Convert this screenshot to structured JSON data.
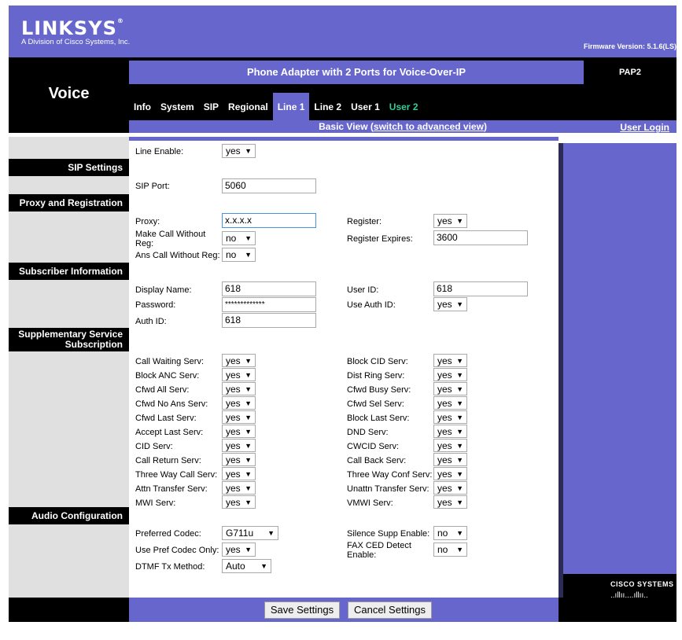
{
  "brand": {
    "logo": "LINKSYS",
    "reg": "®",
    "sub": "A Division of Cisco Systems, Inc."
  },
  "firmware": "Firmware Version: 5.1.6(LS)",
  "section_title": "Voice",
  "banner": "Phone Adapter with 2 Ports for Voice-Over-IP",
  "model": "PAP2",
  "tabs": [
    "Info",
    "System",
    "SIP",
    "Regional",
    "Line 1",
    "Line 2",
    "User 1",
    "User 2"
  ],
  "view": {
    "text": "Basic View",
    "link_open": " (",
    "link": "switch to advanced view",
    "link_close": ")",
    "user_login": "User Login"
  },
  "sections": {
    "sip": "SIP Settings",
    "proxy": "Proxy and Registration",
    "subscriber": "Subscriber Information",
    "supp": "Supplementary Service Subscription",
    "audio": "Audio Configuration"
  },
  "fields": {
    "line_enable": {
      "label": "Line Enable:",
      "value": "yes"
    },
    "sip_port": {
      "label": "SIP Port:",
      "value": "5060"
    },
    "proxy": {
      "label": "Proxy:",
      "value": "x.x.x.x"
    },
    "register": {
      "label": "Register:",
      "value": "yes"
    },
    "make_call": {
      "label": "Make Call Without Reg:",
      "value": "no"
    },
    "reg_expires": {
      "label": "Register Expires:",
      "value": "3600"
    },
    "ans_call": {
      "label": "Ans Call Without Reg:",
      "value": "no"
    },
    "display_name": {
      "label": "Display Name:",
      "value": "618"
    },
    "user_id": {
      "label": "User ID:",
      "value": "618"
    },
    "password": {
      "label": "Password:",
      "value": "*************"
    },
    "use_auth": {
      "label": "Use Auth ID:",
      "value": "yes"
    },
    "auth_id": {
      "label": "Auth ID:",
      "value": "618"
    },
    "pref_codec": {
      "label": "Preferred Codec:",
      "value": "G711u"
    },
    "silence": {
      "label": "Silence Supp Enable:",
      "value": "no"
    },
    "use_pref": {
      "label": "Use Pref Codec Only:",
      "value": "yes"
    },
    "fax_ced": {
      "label": "FAX CED Detect Enable:",
      "value": "no"
    },
    "dtmf": {
      "label": "DTMF Tx Method:",
      "value": "Auto"
    }
  },
  "supp_left": [
    {
      "label": "Call Waiting Serv:",
      "value": "yes"
    },
    {
      "label": "Block ANC Serv:",
      "value": "yes"
    },
    {
      "label": "Cfwd All Serv:",
      "value": "yes"
    },
    {
      "label": "Cfwd No Ans Serv:",
      "value": "yes"
    },
    {
      "label": "Cfwd Last Serv:",
      "value": "yes"
    },
    {
      "label": "Accept Last Serv:",
      "value": "yes"
    },
    {
      "label": "CID Serv:",
      "value": "yes"
    },
    {
      "label": "Call Return Serv:",
      "value": "yes"
    },
    {
      "label": "Three Way Call Serv:",
      "value": "yes"
    },
    {
      "label": "Attn Transfer Serv:",
      "value": "yes"
    },
    {
      "label": "MWI Serv:",
      "value": "yes"
    }
  ],
  "supp_right": [
    {
      "label": "Block CID Serv:",
      "value": "yes"
    },
    {
      "label": "Dist Ring Serv:",
      "value": "yes"
    },
    {
      "label": "Cfwd Busy Serv:",
      "value": "yes"
    },
    {
      "label": "Cfwd Sel Serv:",
      "value": "yes"
    },
    {
      "label": "Block Last Serv:",
      "value": "yes"
    },
    {
      "label": "DND Serv:",
      "value": "yes"
    },
    {
      "label": "CWCID Serv:",
      "value": "yes"
    },
    {
      "label": "Call Back Serv:",
      "value": "yes"
    },
    {
      "label": "Three Way Conf Serv:",
      "value": "yes"
    },
    {
      "label": "Unattn Transfer Serv:",
      "value": "yes"
    },
    {
      "label": "VMWI Serv:",
      "value": "yes"
    }
  ],
  "buttons": {
    "save": "Save Settings",
    "cancel": "Cancel Settings"
  },
  "cisco": {
    "name": "CISCO SYSTEMS",
    "bars": "..ıllıı....ıllıı.."
  },
  "colors": {
    "accent": "#6666cc",
    "dark": "#000000",
    "tab_inactive_user2": "#33cc99"
  }
}
